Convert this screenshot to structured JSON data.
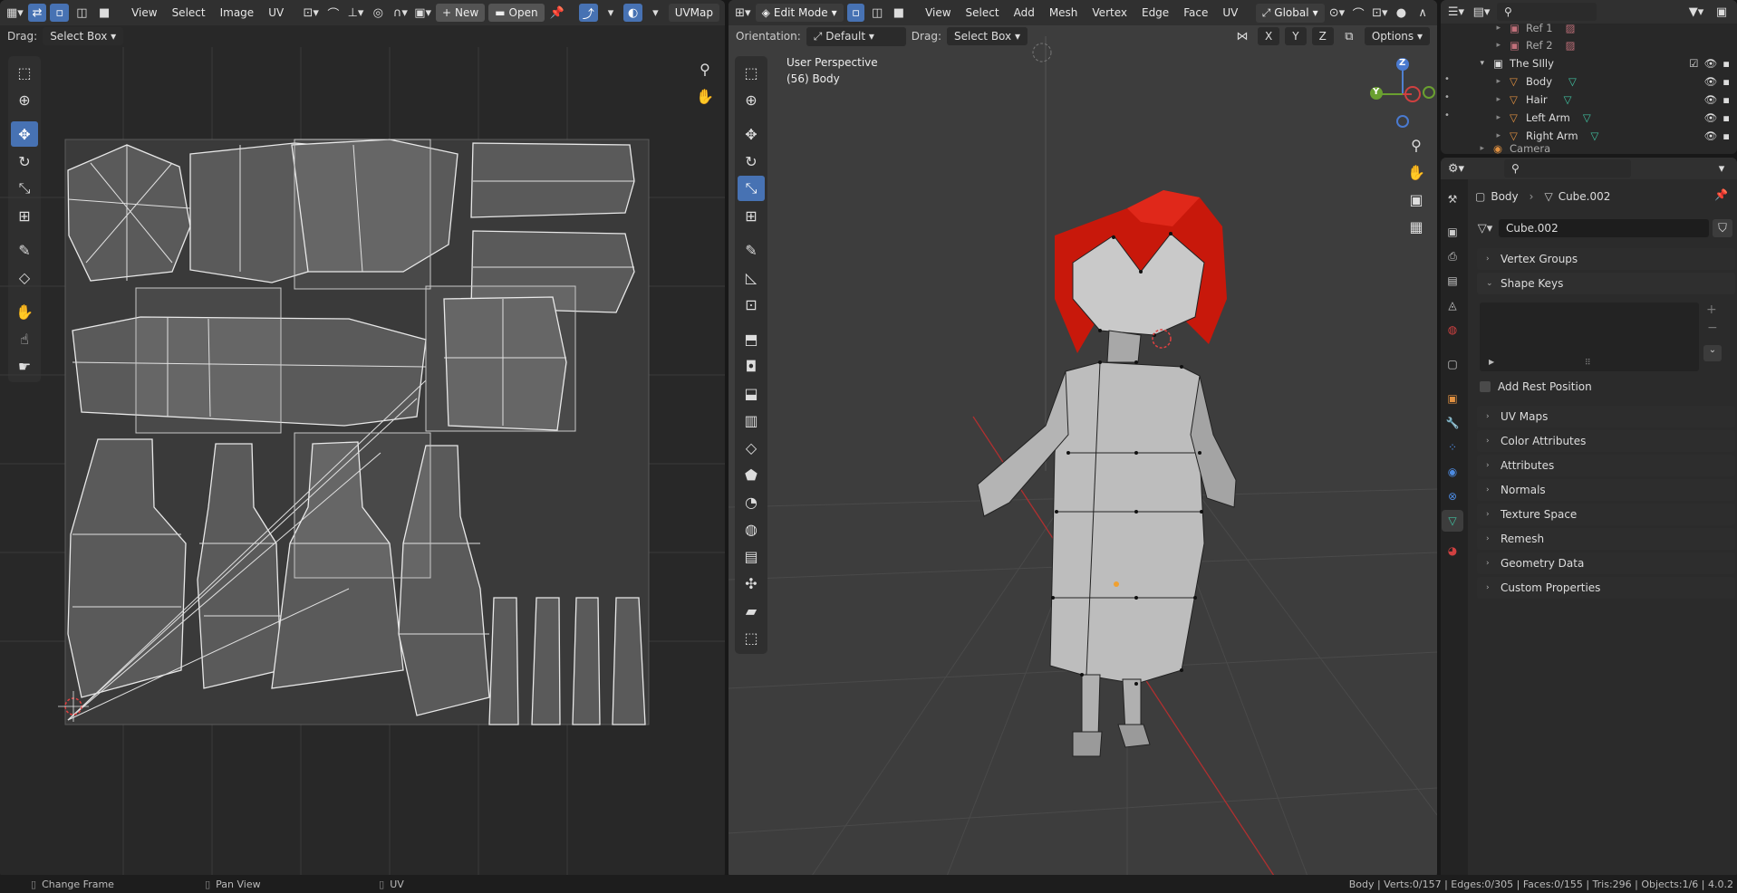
{
  "uv_editor": {
    "menu": [
      "View",
      "Select",
      "Image",
      "UV"
    ],
    "new_label": "New",
    "open_label": "Open",
    "uvmap": "UVMap",
    "drag_label": "Drag:",
    "drag_value": "Select Box"
  },
  "viewport": {
    "mode": "Edit Mode",
    "menu": [
      "View",
      "Select",
      "Add",
      "Mesh",
      "Vertex",
      "Edge",
      "Face",
      "UV"
    ],
    "transform_orientation": "Global",
    "orientation_label": "Orientation:",
    "orientation_value": "Default",
    "drag_label": "Drag:",
    "drag_value": "Select Box",
    "axes": [
      "X",
      "Y",
      "Z"
    ],
    "options_label": "Options",
    "perspective": "User Perspective",
    "object_info": "(56) Body",
    "gizmo": {
      "z": "Z",
      "y": "Y"
    },
    "colors": {
      "hair": "#c8180b",
      "mesh": "#b8b8b8",
      "accent": "#4772b3"
    }
  },
  "outliner": {
    "items": [
      {
        "label": "Ref 1"
      },
      {
        "label": "Ref 2"
      },
      {
        "label": "The SIlly"
      },
      {
        "label": "Body"
      },
      {
        "label": "Hair"
      },
      {
        "label": "Left Arm"
      },
      {
        "label": "Right Arm"
      },
      {
        "label": "Camera"
      }
    ]
  },
  "properties": {
    "breadcrumb": {
      "object": "Body",
      "data": "Cube.002"
    },
    "mesh_name": "Cube.002",
    "panels": [
      "Vertex Groups",
      "Shape Keys",
      "UV Maps",
      "Color Attributes",
      "Attributes",
      "Normals",
      "Texture Space",
      "Remesh",
      "Geometry Data",
      "Custom Properties"
    ],
    "add_rest_position": "Add Rest Position"
  },
  "statusbar": {
    "left": [
      "Change Frame",
      "Pan View",
      "UV"
    ],
    "stats": "Body | Verts:0/157 | Edges:0/305 | Faces:0/155 | Tris:296 | Objects:1/6 | 4.0.2"
  }
}
